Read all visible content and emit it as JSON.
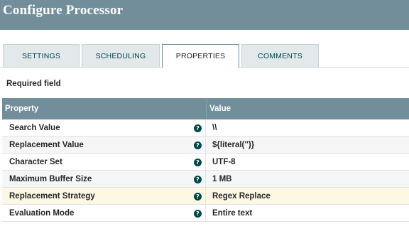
{
  "header": {
    "title": "Configure Processor"
  },
  "tabs": [
    {
      "label": "SETTINGS"
    },
    {
      "label": "SCHEDULING"
    },
    {
      "label": "PROPERTIES"
    },
    {
      "label": "COMMENTS"
    }
  ],
  "required_label": "Required field",
  "grid": {
    "columns": {
      "property": "Property",
      "value": "Value"
    },
    "rows": [
      {
        "property": "Search Value",
        "value": "\\\\"
      },
      {
        "property": "Replacement Value",
        "value": "${literal('')}"
      },
      {
        "property": "Character Set",
        "value": "UTF-8"
      },
      {
        "property": "Maximum Buffer Size",
        "value": "1 MB"
      },
      {
        "property": "Replacement Strategy",
        "value": "Regex Replace"
      },
      {
        "property": "Evaluation Mode",
        "value": "Entire text"
      }
    ]
  },
  "help_icon_glyph": "?",
  "colors": {
    "header_bg": "#728e9b",
    "accent": "#004849",
    "highlight_row": "#fcf8e3"
  }
}
